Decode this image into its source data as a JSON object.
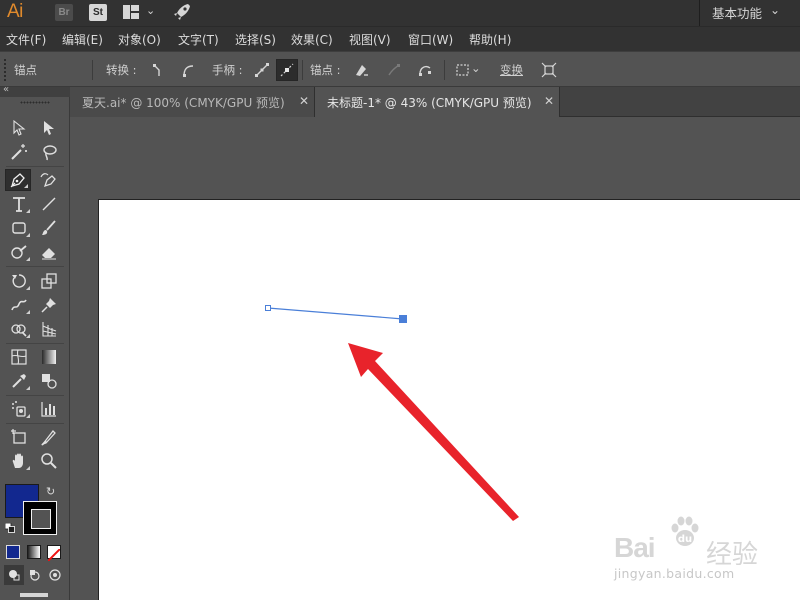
{
  "app": {
    "logo": "Ai",
    "bridge_badge": "Br",
    "stock_badge": "St",
    "workspace": "基本功能"
  },
  "menu": [
    {
      "label": "文件(F)"
    },
    {
      "label": "编辑(E)"
    },
    {
      "label": "对象(O)"
    },
    {
      "label": "文字(T)"
    },
    {
      "label": "选择(S)"
    },
    {
      "label": "效果(C)"
    },
    {
      "label": "视图(V)"
    },
    {
      "label": "窗口(W)"
    },
    {
      "label": "帮助(H)"
    }
  ],
  "control_bar": {
    "context": "锚点",
    "convert_label": "转换 :",
    "handles_label": "手柄 :",
    "anchors_label": "锚点 :",
    "transform_label": "变换"
  },
  "tabs": [
    {
      "label": "夏天.ai* @ 100% (CMYK/GPU 预览)",
      "active": false
    },
    {
      "label": "未标题-1* @ 43% (CMYK/GPU 预览)",
      "active": true
    }
  ],
  "tools": {
    "active_tool": "pen-tool",
    "fill_color": "#12288f",
    "stroke_color": "#000000"
  },
  "artwork": {
    "path_color": "#4a7fd8",
    "annotation_arrow_color": "#e8232b"
  },
  "watermark": {
    "brand": "Bai",
    "brand_suffix": "经验",
    "url": "jingyan.baidu.com"
  }
}
